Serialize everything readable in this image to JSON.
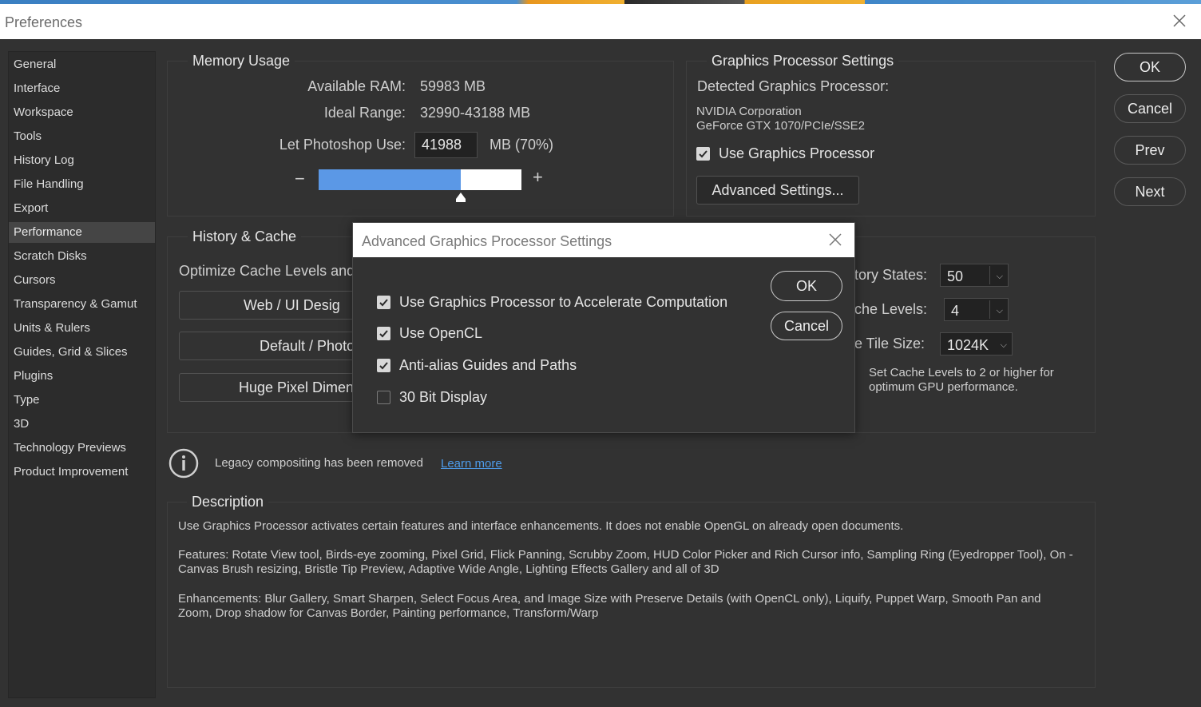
{
  "window": {
    "title": "Preferences"
  },
  "sidebar": {
    "items": [
      {
        "label": "General"
      },
      {
        "label": "Interface"
      },
      {
        "label": "Workspace"
      },
      {
        "label": "Tools"
      },
      {
        "label": "History Log"
      },
      {
        "label": "File Handling"
      },
      {
        "label": "Export"
      },
      {
        "label": "Performance",
        "active": true
      },
      {
        "label": "Scratch Disks"
      },
      {
        "label": "Cursors"
      },
      {
        "label": "Transparency & Gamut"
      },
      {
        "label": "Units & Rulers"
      },
      {
        "label": "Guides, Grid & Slices"
      },
      {
        "label": "Plugins"
      },
      {
        "label": "Type"
      },
      {
        "label": "3D"
      },
      {
        "label": "Technology Previews"
      },
      {
        "label": "Product Improvement"
      }
    ]
  },
  "memory": {
    "title": "Memory Usage",
    "available_label": "Available RAM:",
    "available_value": "59983 MB",
    "ideal_label": "Ideal Range:",
    "ideal_value": "32990-43188 MB",
    "use_label": "Let Photoshop Use:",
    "use_value": "41988",
    "use_unit": "MB (70%)",
    "minus": "−",
    "plus": "+",
    "slider_fraction": 0.7
  },
  "gpu": {
    "title": "Graphics Processor Settings",
    "detected_label": "Detected Graphics Processor:",
    "vendor": "NVIDIA Corporation",
    "model": "GeForce GTX 1070/PCIe/SSE2",
    "use_gpu_label": "Use Graphics Processor",
    "use_gpu_checked": true,
    "advanced_label": "Advanced Settings..."
  },
  "buttons": {
    "ok": "OK",
    "cancel": "Cancel",
    "prev": "Prev",
    "next": "Next"
  },
  "history": {
    "title": "History & Cache",
    "optimize_label": "Optimize Cache Levels and",
    "preset_buttons": [
      "Web / UI Desig",
      "Default / Photo",
      "Huge Pixel Dimen"
    ],
    "states_label": "tory States:",
    "states_value": "50",
    "levels_label": "che Levels:",
    "levels_value": "4",
    "tile_label": "e Tile Size:",
    "tile_value": "1024K",
    "hint": "Set Cache Levels to 2 or higher for optimum GPU performance."
  },
  "legacy": {
    "text": "Legacy compositing has been removed",
    "link": "Learn more"
  },
  "description": {
    "title": "Description",
    "p1": "Use Graphics Processor activates certain features and interface enhancements. It does not enable OpenGL on already open documents.",
    "p2": "Features: Rotate View tool, Birds-eye zooming, Pixel Grid, Flick Panning, Scrubby Zoom, HUD Color Picker and Rich Cursor info, Sampling Ring (Eyedropper Tool), On -Canvas Brush resizing, Bristle Tip Preview, Adaptive Wide Angle, Lighting Effects Gallery and all of 3D",
    "p3": "Enhancements: Blur Gallery, Smart Sharpen, Select Focus Area, and Image Size with Preserve Details (with OpenCL only), Liquify, Puppet Warp, Smooth Pan and Zoom, Drop shadow for Canvas Border, Painting performance, Transform/Warp"
  },
  "modal": {
    "title": "Advanced Graphics Processor Settings",
    "ok": "OK",
    "cancel": "Cancel",
    "options": [
      {
        "label": "Use Graphics Processor to Accelerate Computation",
        "checked": true
      },
      {
        "label": "Use OpenCL",
        "checked": true
      },
      {
        "label": "Anti-alias Guides and Paths",
        "checked": true
      },
      {
        "label": "30 Bit Display",
        "checked": false
      }
    ]
  },
  "colors": {
    "slider_fill": "#5b98e6",
    "link": "#4d9bea",
    "panel": "#323232"
  }
}
